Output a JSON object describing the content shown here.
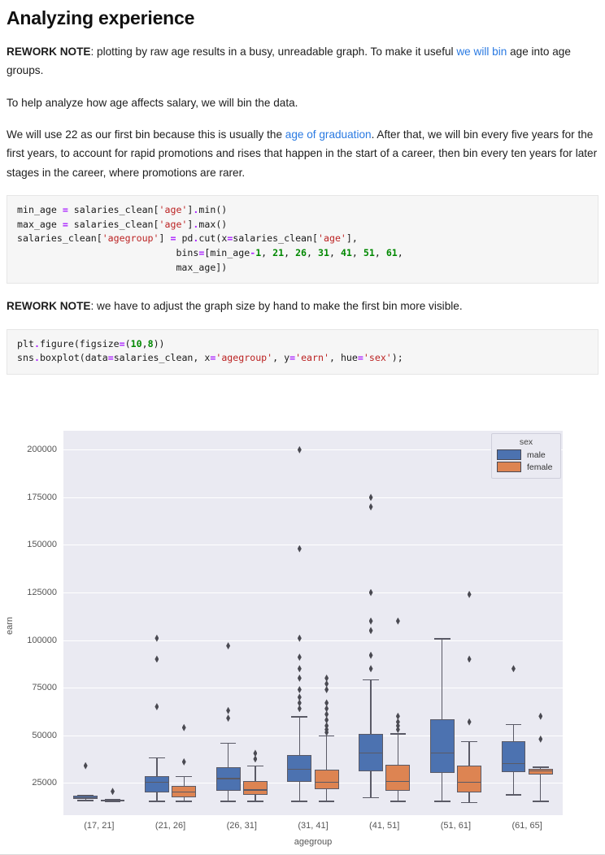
{
  "heading": "Analyzing experience",
  "paragraphs": [
    {
      "id": "p1",
      "bold_prefix": "REWORK NOTE",
      "text_a": ": plotting by raw age results in a busy, unreadable graph. To make it useful ",
      "link": "we will bin",
      "text_b": " age into age groups."
    },
    {
      "id": "p2",
      "text_a": "To help analyze how age affects salary, we will bin the data."
    },
    {
      "id": "p3",
      "text_a": "We will use 22 as our first bin because this is usually the ",
      "link": "age of graduation",
      "text_b": ". After that, we will bin every five years for the first years, to account for rapid promotions and rises that happen in the start of a career, then bin every ten years for later stages in the career, where promotions are rarer."
    },
    {
      "id": "p4",
      "bold_prefix": "REWORK NOTE",
      "text_a": ": we have to adjust the graph size by hand to make the first bin more visible."
    }
  ],
  "code_blocks": [
    {
      "id": "binning-code",
      "lines": [
        "min_age = salaries_clean['age'].min()",
        "max_age = salaries_clean['age'].max()",
        "salaries_clean['agegroup'] = pd.cut(x=salaries_clean['age'],",
        "                            bins=[min_age-1, 21, 26, 31, 41, 51, 61,",
        "                            max_age])"
      ]
    },
    {
      "id": "plot-code",
      "lines": [
        "plt.figure(figsize=(10,8))",
        "sns.boxplot(data=salaries_clean, x='agegroup', y='earn', hue='sex');"
      ]
    }
  ],
  "colors": {
    "link": "#2a7ae2",
    "male": "#4c72b0",
    "female": "#dd8452",
    "plot_background": "#eaeaf2",
    "grid": "#ffffff",
    "box_edge": "#5a5a66",
    "code_background": "#f6f6f6"
  },
  "chart_data": {
    "type": "box",
    "title": "",
    "xlabel": "agegroup",
    "ylabel": "earn",
    "ylim": [
      8000,
      210000
    ],
    "yticks": [
      25000,
      50000,
      75000,
      100000,
      125000,
      150000,
      175000,
      200000
    ],
    "ytick_labels": [
      "25000",
      "50000",
      "75000",
      "100000",
      "125000",
      "150000",
      "175000",
      "200000"
    ],
    "grid": true,
    "legend": {
      "title": "sex",
      "position": "upper right",
      "entries": [
        {
          "label": "male",
          "color": "#4c72b0"
        },
        {
          "label": "female",
          "color": "#dd8452"
        }
      ]
    },
    "categories": [
      "(17, 21]",
      "(21, 26]",
      "(26, 31]",
      "(31, 41]",
      "(41, 51]",
      "(51, 61]",
      "(61, 65]"
    ],
    "series": [
      {
        "name": "male",
        "color": "#4c72b0",
        "boxes": [
          {
            "category": "(17, 21]",
            "whisker_low": 16000,
            "q1": 16600,
            "median": 17400,
            "q3": 18200,
            "whisker_high": 18600,
            "outliers": [
              34000
            ]
          },
          {
            "category": "(21, 26]",
            "whisker_low": 15500,
            "q1": 20000,
            "median": 25500,
            "q3": 28500,
            "whisker_high": 38500,
            "outliers": [
              65000,
              90000,
              101000
            ]
          },
          {
            "category": "(26, 31]",
            "whisker_low": 15500,
            "q1": 21000,
            "median": 27500,
            "q3": 33000,
            "whisker_high": 46000,
            "outliers": [
              59000,
              63000,
              97000
            ]
          },
          {
            "category": "(31, 41]",
            "whisker_low": 15500,
            "q1": 25500,
            "median": 32500,
            "q3": 39500,
            "whisker_high": 60000,
            "outliers": [
              64000,
              67000,
              70000,
              74000,
              80000,
              85000,
              91000,
              101000,
              148000,
              200000
            ]
          },
          {
            "category": "(41, 51]",
            "whisker_low": 17500,
            "q1": 31000,
            "median": 41000,
            "q3": 50500,
            "whisker_high": 79500,
            "outliers": [
              85000,
              92000,
              105000,
              110000,
              125000,
              170000,
              175000
            ]
          },
          {
            "category": "(51, 61]",
            "whisker_low": 15500,
            "q1": 30000,
            "median": 41000,
            "q3": 58500,
            "whisker_high": 101000,
            "outliers": []
          },
          {
            "category": "(61, 65]",
            "whisker_low": 19000,
            "q1": 30500,
            "median": 35500,
            "q3": 47000,
            "whisker_high": 56000,
            "outliers": [
              85000
            ]
          }
        ]
      },
      {
        "name": "female",
        "color": "#dd8452",
        "boxes": [
          {
            "category": "(17, 21]",
            "whisker_low": 15300,
            "q1": 15600,
            "median": 15900,
            "q3": 16200,
            "whisker_high": 16500,
            "outliers": [
              20500
            ]
          },
          {
            "category": "(21, 26]",
            "whisker_low": 15500,
            "q1": 17500,
            "median": 20500,
            "q3": 23500,
            "whisker_high": 28500,
            "outliers": [
              36000,
              54000
            ]
          },
          {
            "category": "(26, 31]",
            "whisker_low": 15500,
            "q1": 18500,
            "median": 21500,
            "q3": 26000,
            "whisker_high": 34000,
            "outliers": [
              37500,
              40500
            ]
          },
          {
            "category": "(31, 41]",
            "whisker_low": 15500,
            "q1": 21500,
            "median": 25500,
            "q3": 32000,
            "whisker_high": 50000,
            "outliers": [
              51500,
              53000,
              55000,
              58000,
              61000,
              64000,
              67000,
              74000,
              77000,
              80000
            ]
          },
          {
            "category": "(41, 51]",
            "whisker_low": 15500,
            "q1": 21000,
            "median": 26000,
            "q3": 34500,
            "whisker_high": 51000,
            "outliers": [
              53000,
              55000,
              57000,
              60000,
              110000
            ]
          },
          {
            "category": "(51, 61]",
            "whisker_low": 15000,
            "q1": 20000,
            "median": 25500,
            "q3": 34000,
            "whisker_high": 47000,
            "outliers": [
              57000,
              90000,
              124000
            ]
          },
          {
            "category": "(61, 65]",
            "whisker_low": 15500,
            "q1": 29500,
            "median": 31500,
            "q3": 32500,
            "whisker_high": 33500,
            "outliers": [
              48000,
              60000
            ]
          }
        ]
      }
    ]
  }
}
